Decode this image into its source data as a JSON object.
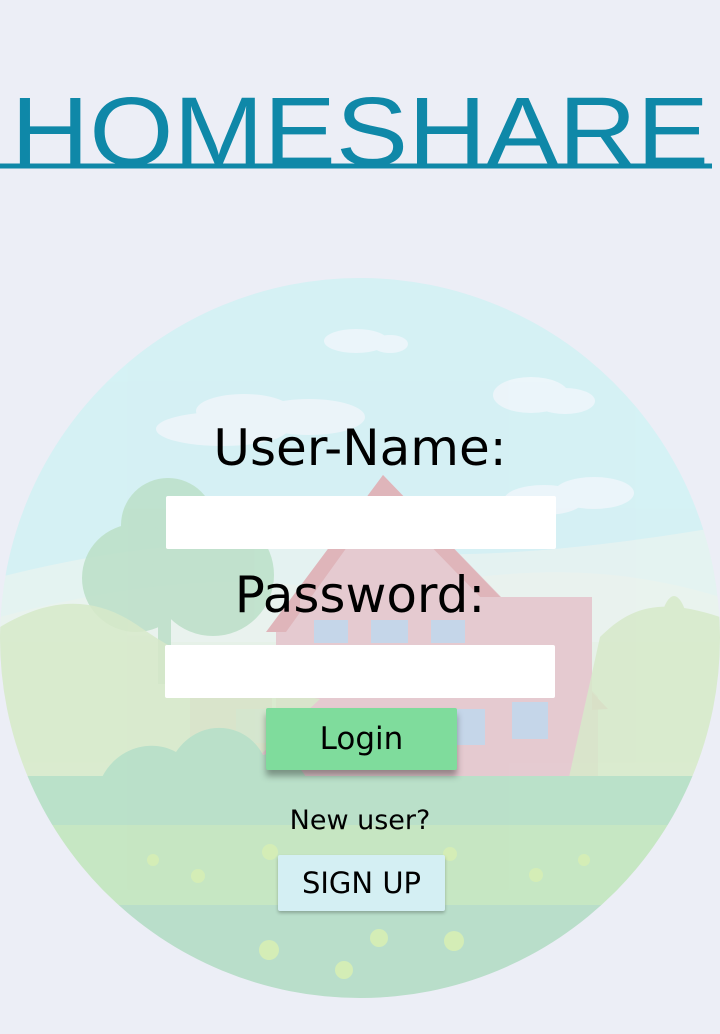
{
  "app": {
    "logo_text": "HOMESHARE"
  },
  "login_form": {
    "username_label": "User-Name:",
    "username_value": "",
    "password_label": "Password:",
    "password_value": "",
    "login_button_label": "Login",
    "new_user_text": "New user?",
    "signup_button_label": "SIGN UP"
  },
  "colors": {
    "background": "#eceef6",
    "logo": "#0f88a8",
    "login_button": "#7fdc9c",
    "signup_button": "#d4eff3",
    "input_background": "#ffffff"
  },
  "illustration": {
    "subject": "house-landscape-illustration"
  }
}
